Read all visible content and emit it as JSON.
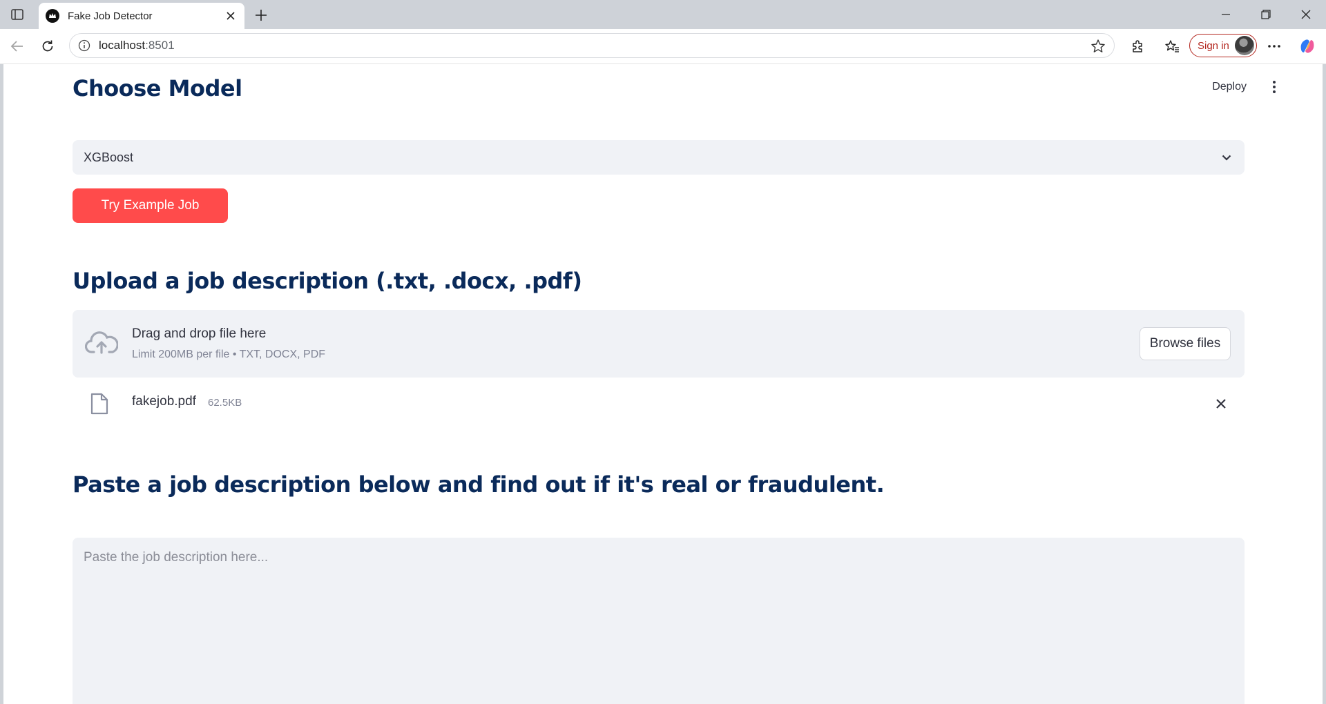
{
  "browser": {
    "tab_title": "Fake Job Detector",
    "url_host": "localhost",
    "url_port": ":8501",
    "signin_label": "Sign in"
  },
  "app": {
    "deploy_label": "Deploy",
    "choose_model_heading": "Choose Model",
    "model_select_value": "XGBoost",
    "example_button_label": "Try Example Job",
    "upload_heading": "Upload a job description (.txt, .docx, .pdf)",
    "dropzone_title": "Drag and drop file here",
    "dropzone_hint": "Limit 200MB per file • TXT, DOCX, PDF",
    "browse_button_label": "Browse files",
    "uploaded_file": {
      "name": "fakejob.pdf",
      "size": "62.5KB"
    },
    "paste_heading": "Paste a job description below and find out if it's real or fraudulent.",
    "paste_placeholder": "Paste the job description here..."
  },
  "colors": {
    "heading": "#0a2a5a",
    "primary_button": "#ff4b4b",
    "input_bg": "#f0f2f6"
  }
}
